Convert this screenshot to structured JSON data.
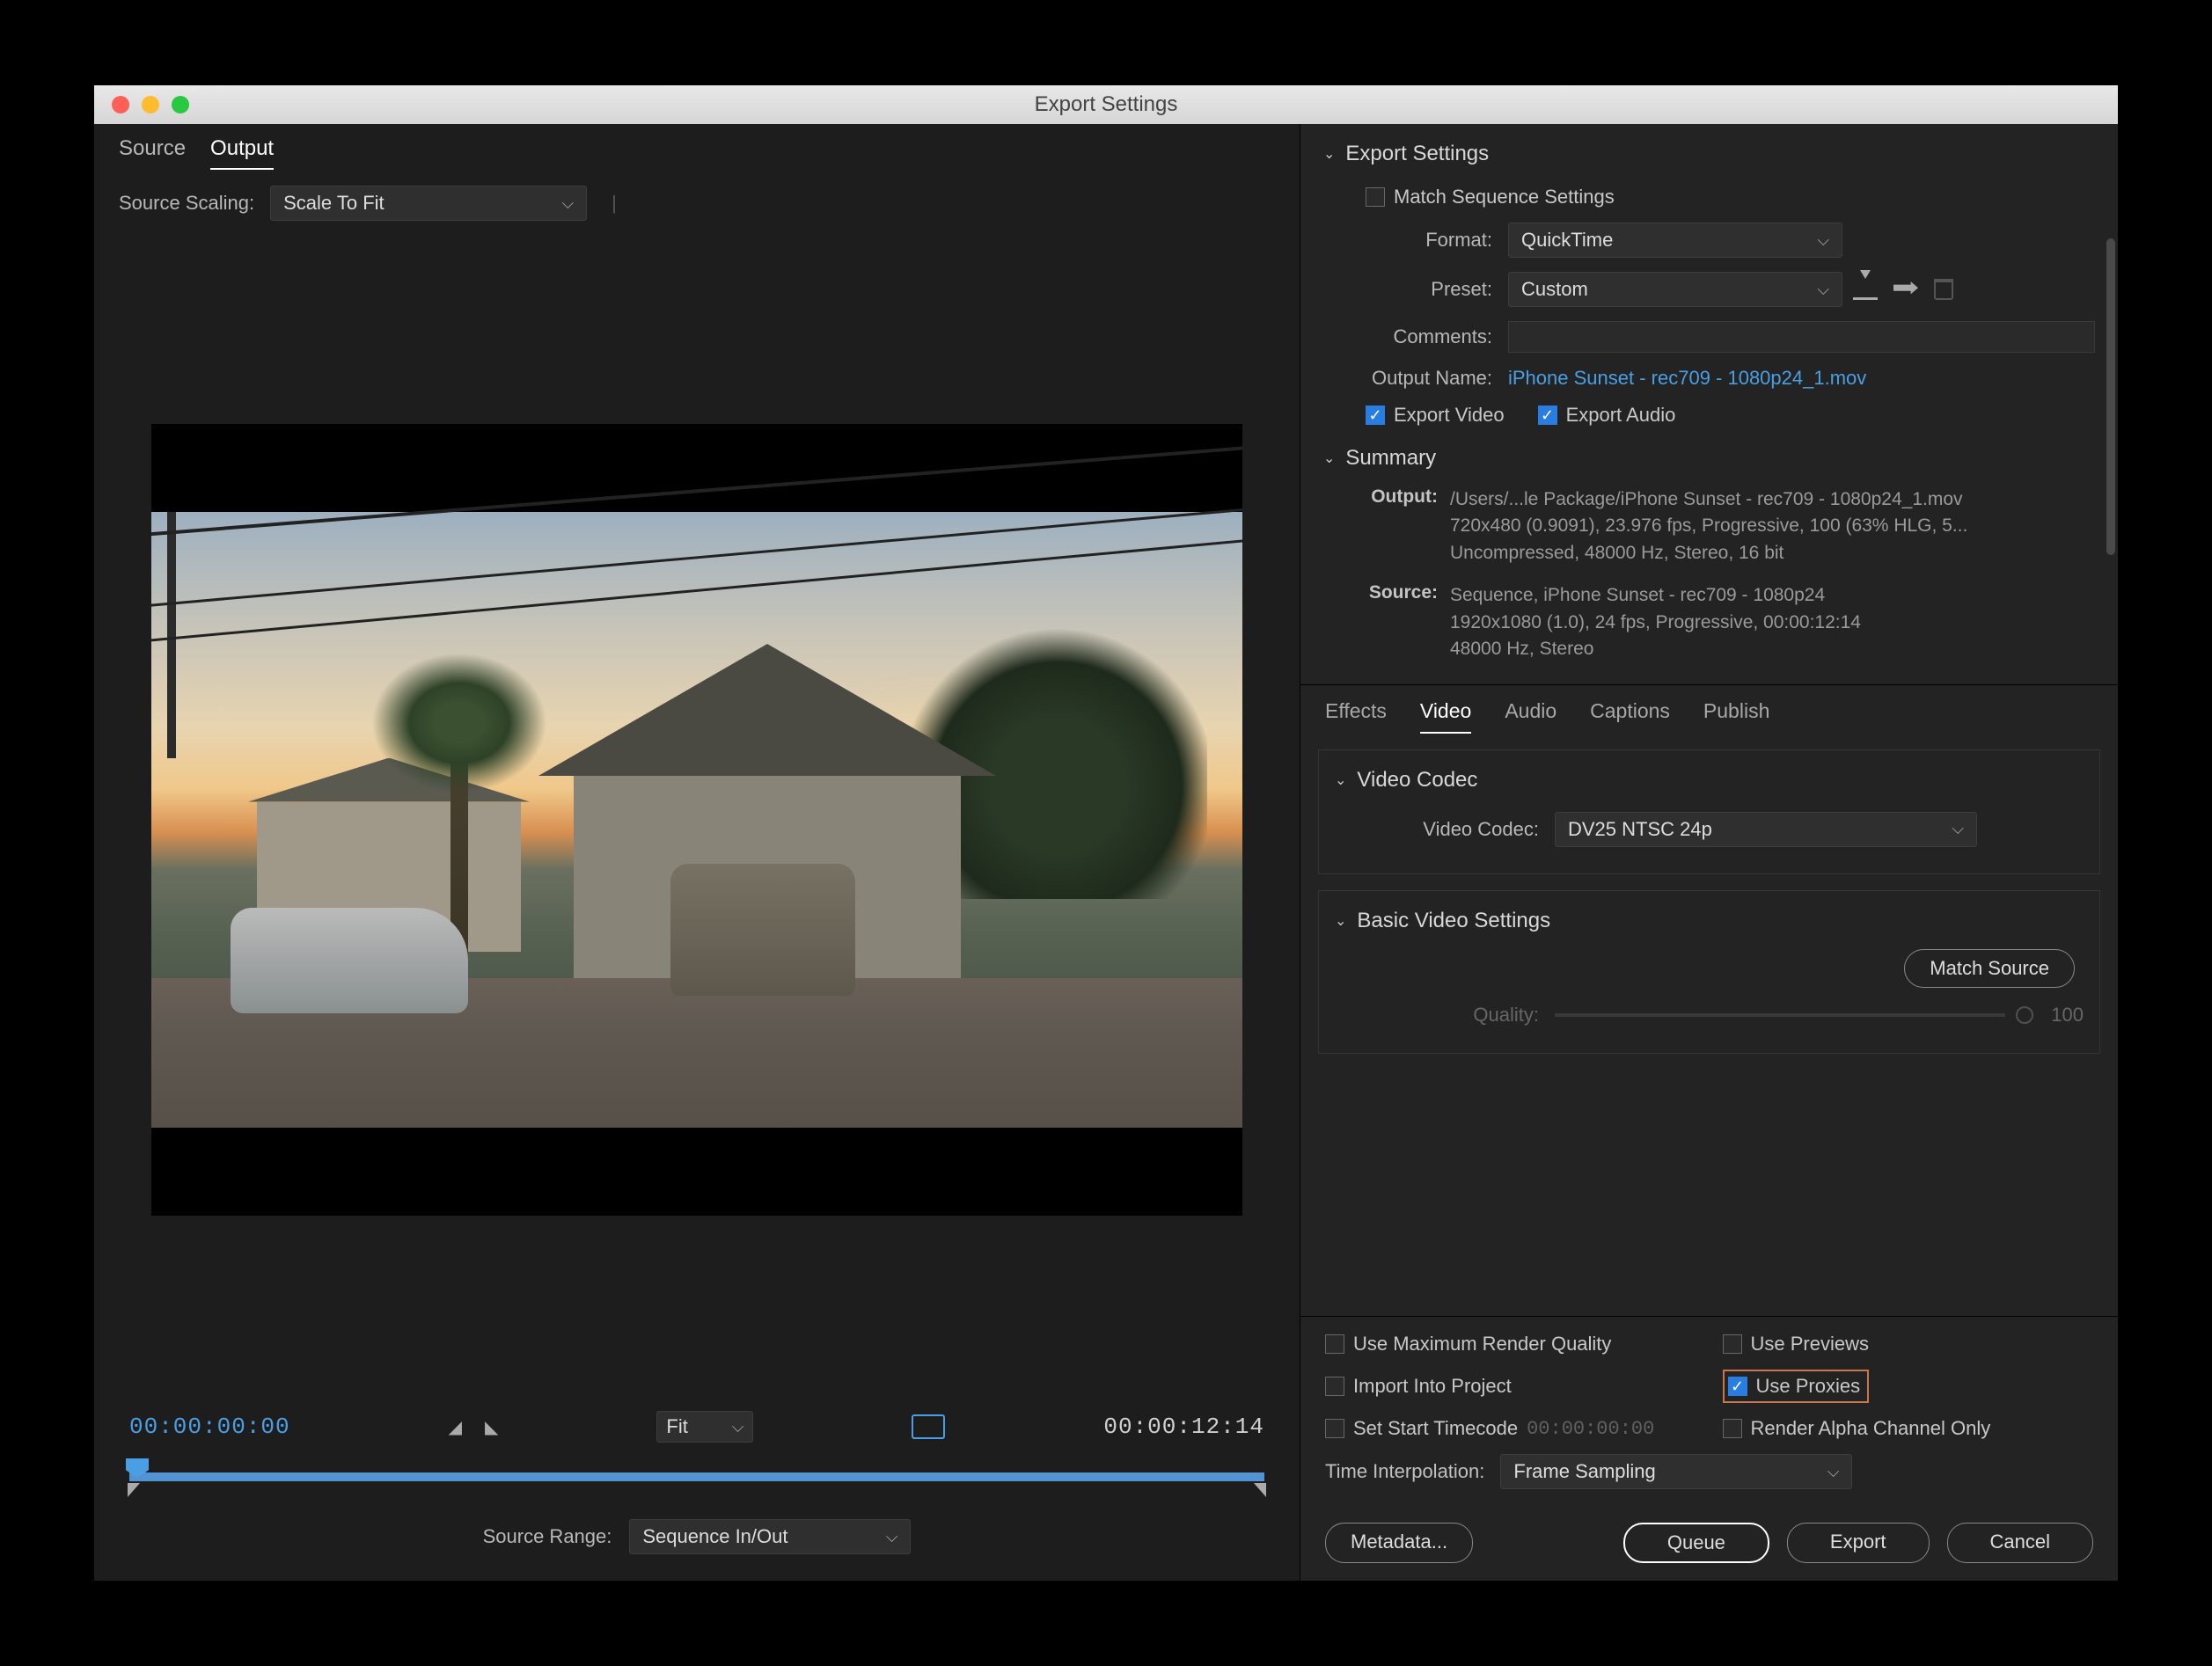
{
  "window": {
    "title": "Export Settings"
  },
  "left": {
    "tabs": {
      "source": "Source",
      "output": "Output"
    },
    "scaling_label": "Source Scaling:",
    "scaling_value": "Scale To Fit",
    "tc_in": "00:00:00:00",
    "tc_out": "00:00:12:14",
    "fit_label": "Fit",
    "range_label": "Source Range:",
    "range_value": "Sequence In/Out"
  },
  "export": {
    "header": "Export Settings",
    "match_seq": "Match Sequence Settings",
    "format_label": "Format:",
    "format_value": "QuickTime",
    "preset_label": "Preset:",
    "preset_value": "Custom",
    "comments_label": "Comments:",
    "output_name_label": "Output Name:",
    "output_name_value": "iPhone Sunset - rec709 - 1080p24_1.mov",
    "export_video": "Export Video",
    "export_audio": "Export Audio",
    "summary_label": "Summary",
    "summary_output_label": "Output:",
    "summary_output_l1": "/Users/...le Package/iPhone Sunset - rec709 - 1080p24_1.mov",
    "summary_output_l2": "720x480 (0.9091), 23.976 fps, Progressive, 100 (63% HLG, 5...",
    "summary_output_l3": "Uncompressed, 48000 Hz, Stereo, 16 bit",
    "summary_source_label": "Source:",
    "summary_source_l1": "Sequence, iPhone Sunset - rec709 - 1080p24",
    "summary_source_l2": "1920x1080 (1.0), 24 fps, Progressive, 00:00:12:14",
    "summary_source_l3": "48000 Hz, Stereo"
  },
  "tabs2": {
    "effects": "Effects",
    "video": "Video",
    "audio": "Audio",
    "captions": "Captions",
    "publish": "Publish"
  },
  "codec": {
    "header": "Video Codec",
    "label": "Video Codec:",
    "value": "DV25 NTSC 24p",
    "basic_header": "Basic Video Settings",
    "match_source": "Match Source",
    "quality_label": "Quality:",
    "quality_value": "100"
  },
  "bottom": {
    "max_quality": "Use Maximum Render Quality",
    "use_previews": "Use Previews",
    "import_project": "Import Into Project",
    "use_proxies": "Use Proxies",
    "set_start_tc": "Set Start Timecode",
    "tc_placeholder": "00:00:00:00",
    "render_alpha": "Render Alpha Channel Only",
    "time_interp_label": "Time Interpolation:",
    "time_interp_value": "Frame Sampling"
  },
  "buttons": {
    "metadata": "Metadata...",
    "queue": "Queue",
    "export": "Export",
    "cancel": "Cancel"
  }
}
